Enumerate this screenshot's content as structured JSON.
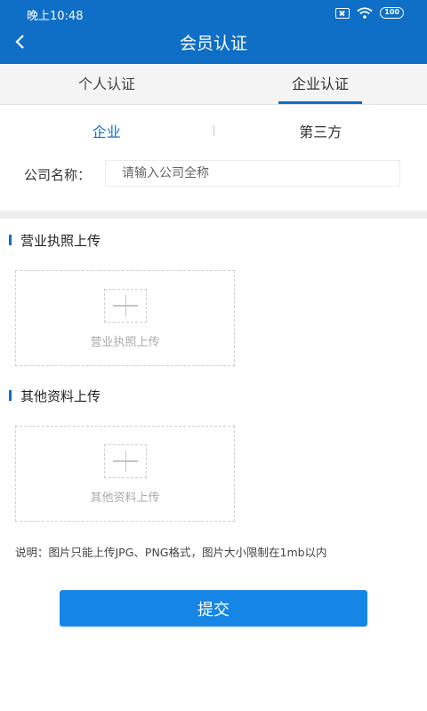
{
  "status_bar": {
    "time": "晚上10:48",
    "battery": "100"
  },
  "header": {
    "title": "会员认证"
  },
  "main_tabs": [
    {
      "label": "个人认证",
      "active": false
    },
    {
      "label": "企业认证",
      "active": true
    }
  ],
  "sub_tabs": [
    {
      "label": "企业",
      "active": true
    },
    {
      "label": "第三方",
      "active": false
    }
  ],
  "company": {
    "label": "公司名称：",
    "placeholder": "请输入公司全称",
    "value": ""
  },
  "license": {
    "title": "营业执照上传",
    "upload_label": "营业执照上传"
  },
  "other": {
    "title": "其他资料上传",
    "upload_label": "其他资料上传"
  },
  "note": "说明：图片只能上传JPG、PNG格式，图片大小限制在1mb以内",
  "submit_label": "提交",
  "colors": {
    "primary": "#0f6fc6",
    "button": "#1585e6"
  }
}
